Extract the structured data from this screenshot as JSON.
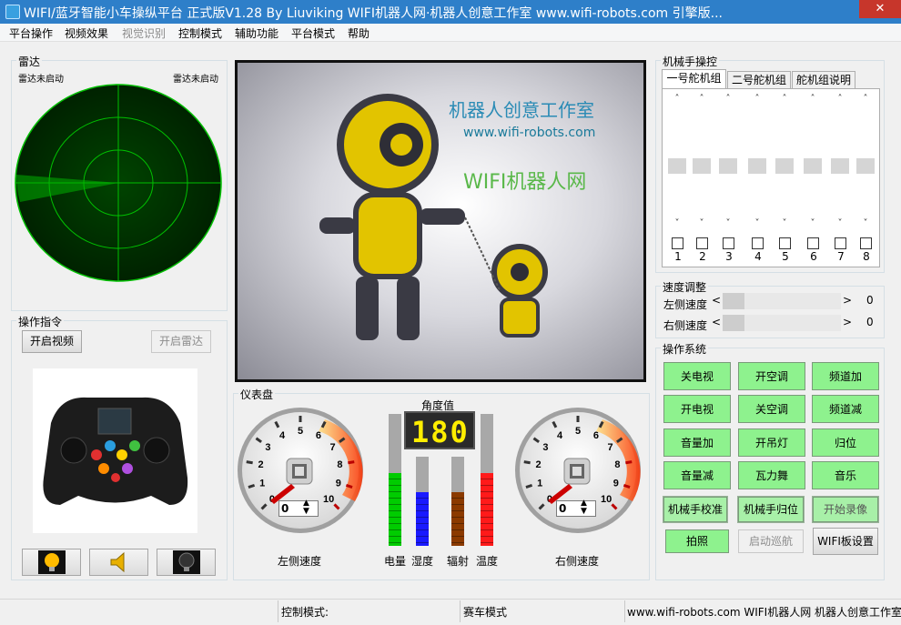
{
  "window": {
    "title": "WIFI/蓝牙智能小车操纵平台 正式版V1.28 By  Liuviking   WIFI机器人网·机器人创意工作室    www.wifi-robots.com    引擎版...",
    "close_glyph": "✕"
  },
  "menu": [
    {
      "label": "平台操作",
      "enabled": true
    },
    {
      "label": "视频效果",
      "enabled": true
    },
    {
      "label": "视觉识别",
      "enabled": false
    },
    {
      "label": "控制模式",
      "enabled": true
    },
    {
      "label": "辅助功能",
      "enabled": true
    },
    {
      "label": "平台模式",
      "enabled": true
    },
    {
      "label": "帮助",
      "enabled": true
    }
  ],
  "radar": {
    "group_title": "雷达",
    "left_status": "雷达未启动",
    "right_status": "雷达未启动",
    "color": "#00d200"
  },
  "commands": {
    "group_title": "操作指令",
    "open_video": "开启视频",
    "open_radar": "开启雷达"
  },
  "bottom_icons": [
    "light-on-icon",
    "speaker-icon",
    "light-off-icon"
  ],
  "video": {
    "watermark_title": "机器人创意工作室",
    "watermark_url": "www.wifi-robots.com",
    "watermark_brand": "WIFI机器人网"
  },
  "dashboard": {
    "group_title": "仪表盘",
    "angle_label": "角度值",
    "angle_value": "180",
    "left_gauge": {
      "label": "左侧速度",
      "value": "0",
      "ticks": [
        "0",
        "1",
        "2",
        "3",
        "4",
        "5",
        "6",
        "7",
        "8",
        "9",
        "10"
      ]
    },
    "right_gauge": {
      "label": "右侧速度",
      "value": "0",
      "ticks": [
        "0",
        "1",
        "2",
        "3",
        "4",
        "5",
        "6",
        "7",
        "8",
        "9",
        "10"
      ]
    },
    "bars": [
      {
        "label": "电量",
        "color": "#00cc00",
        "level": 0.55
      },
      {
        "label": "湿度",
        "color": "#1a1aff",
        "level": 0.6
      },
      {
        "label": "辐射",
        "color": "#8b3a00",
        "level": 0.6
      },
      {
        "label": "温度",
        "color": "#ff1a1a",
        "level": 0.55
      }
    ]
  },
  "arm": {
    "group_title": "机械手操控",
    "tabs": [
      "一号舵机组",
      "二号舵机组",
      "舵机组说明"
    ],
    "servos": [
      "1",
      "2",
      "3",
      "4",
      "5",
      "6",
      "7",
      "8"
    ],
    "up_glyph": "˄",
    "down_glyph": "˅"
  },
  "speed": {
    "group_title": "速度调整",
    "left_label": "左侧速度",
    "right_label": "右侧速度",
    "left_value": "0",
    "right_value": "0",
    "prev_glyph": "<",
    "next_glyph": ">"
  },
  "ops": {
    "group_title": "操作系统",
    "buttons": [
      [
        "关电视",
        "开空调",
        "频道加"
      ],
      [
        "开电视",
        "关空调",
        "频道减"
      ],
      [
        "音量加",
        "开吊灯",
        "归位"
      ],
      [
        "音量减",
        "瓦力舞",
        "音乐"
      ]
    ],
    "arm_calibrate": "机械手校准",
    "arm_home": "机械手归位",
    "start_record": "开始录像",
    "photo": "拍照",
    "auto_cruise": "启动巡航",
    "wifi_settings": "WIFI板设置"
  },
  "status": {
    "control_mode": "控制模式:",
    "race_mode": "赛车模式",
    "footer": "www.wifi-robots.com WIFI机器人网 机器人创意工作室"
  }
}
